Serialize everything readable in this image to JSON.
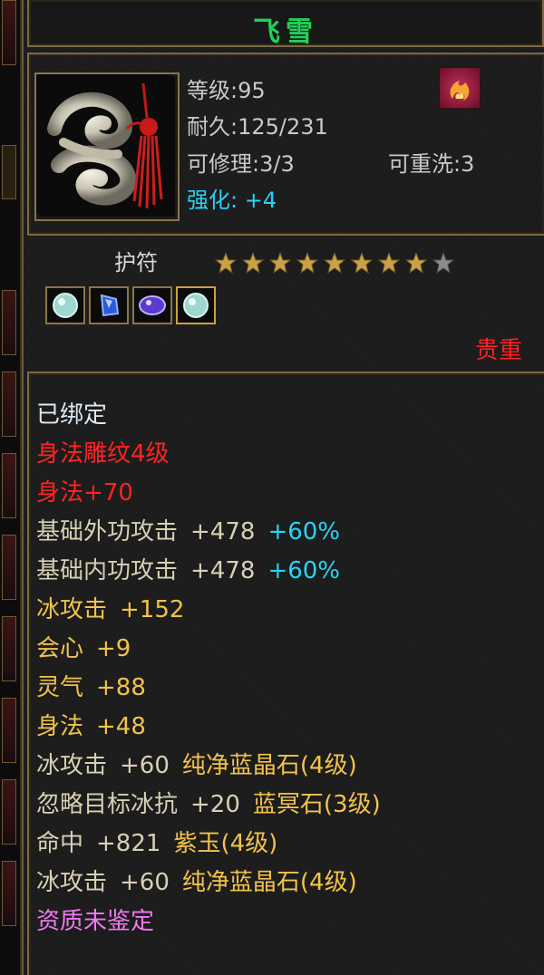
{
  "item": {
    "name": "飞雪",
    "level": "等级:95",
    "durability": "耐久:125/231",
    "repair": "可修理:3/3",
    "rewash": "可重洗:3",
    "enhance": "强化: +4",
    "type": "护符",
    "stars_filled": 8,
    "stars_total": 9,
    "rarity": "贵重"
  },
  "gems": [
    "white-crystal-gem",
    "blue-crystal-gem",
    "purple-crystal-gem",
    "white-crystal-gem"
  ],
  "attributes": {
    "bound": "已绑定",
    "engraving": "身法雕纹4级",
    "engraving_bonus": "身法+70",
    "ext_attack": {
      "name": "基础外功攻击",
      "value": "+478",
      "pct": "+60%"
    },
    "int_attack": {
      "name": "基础内功攻击",
      "value": "+478",
      "pct": "+60%"
    },
    "ice_attack": {
      "name": "冰攻击",
      "value": "+152"
    },
    "crit": {
      "name": "会心",
      "value": "+9"
    },
    "spirit": {
      "name": "灵气",
      "value": "+88"
    },
    "agility": {
      "name": "身法",
      "value": "+48"
    },
    "gem1": {
      "name": "冰攻击",
      "value": "+60",
      "gem": "纯净蓝晶石(4级)"
    },
    "gem2": {
      "name": "忽略目标冰抗",
      "value": "+20",
      "gem": "蓝冥石(3级)"
    },
    "gem3": {
      "name": "命中",
      "value": "+821",
      "gem": "紫玉(4级)"
    },
    "gem4": {
      "name": "冰攻击",
      "value": "+60",
      "gem": "纯净蓝晶石(4级)"
    },
    "quality": "资质未鉴定"
  },
  "colors": {
    "name": "#21d15a",
    "cyan": "#28d4f5",
    "red": "#ff2424",
    "gold": "#f2c34a",
    "pink": "#f178f2",
    "frame": "#7a6a45"
  }
}
